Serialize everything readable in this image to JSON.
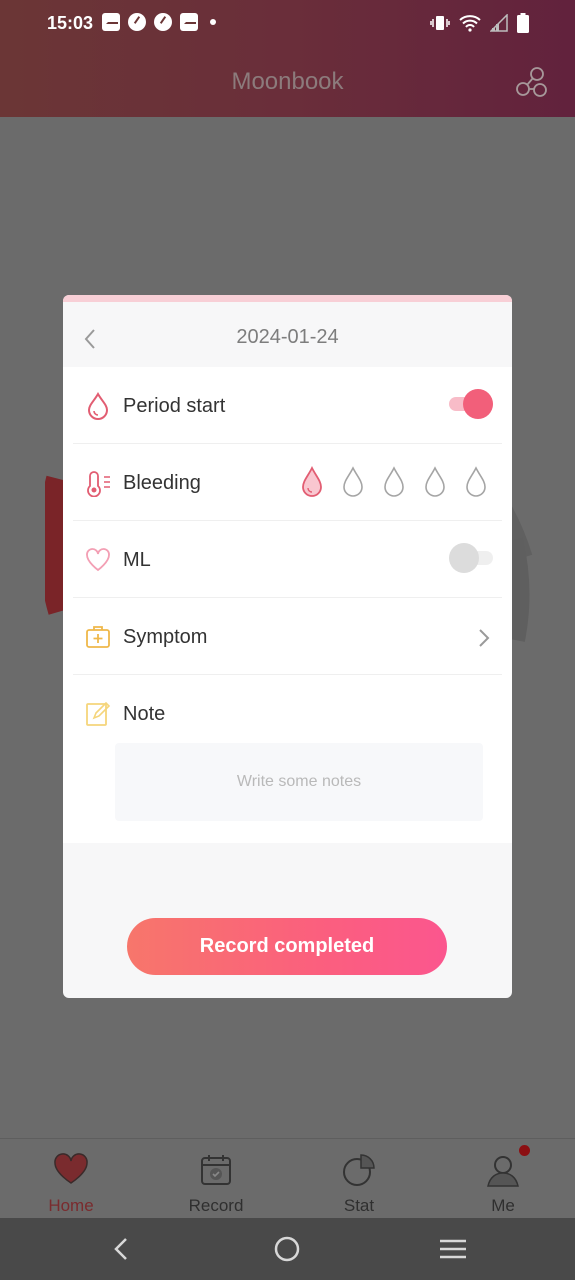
{
  "status_bar": {
    "time": "15:03"
  },
  "app": {
    "title": "Moonbook"
  },
  "modal": {
    "date": "2024-01-24",
    "rows": {
      "period_start": {
        "label": "Period start",
        "toggle_on": true
      },
      "bleeding": {
        "label": "Bleeding",
        "level": 1,
        "max_level": 5
      },
      "ml": {
        "label": "ML",
        "toggle_on": false
      },
      "symptom": {
        "label": "Symptom"
      },
      "note": {
        "label": "Note",
        "placeholder": "Write some notes"
      }
    },
    "button_label": "Record completed"
  },
  "bottom_nav": {
    "tabs": [
      {
        "label": "Home",
        "icon": "heart-icon",
        "active": true
      },
      {
        "label": "Record",
        "icon": "calendar-check-icon",
        "active": false
      },
      {
        "label": "Stat",
        "icon": "pie-chart-icon",
        "active": false
      },
      {
        "label": "Me",
        "icon": "person-icon",
        "active": false,
        "badge": true
      }
    ]
  },
  "colors": {
    "accent": "#f25f7a",
    "header": "#6a2e3a",
    "active_tab": "#7a2b2e"
  }
}
